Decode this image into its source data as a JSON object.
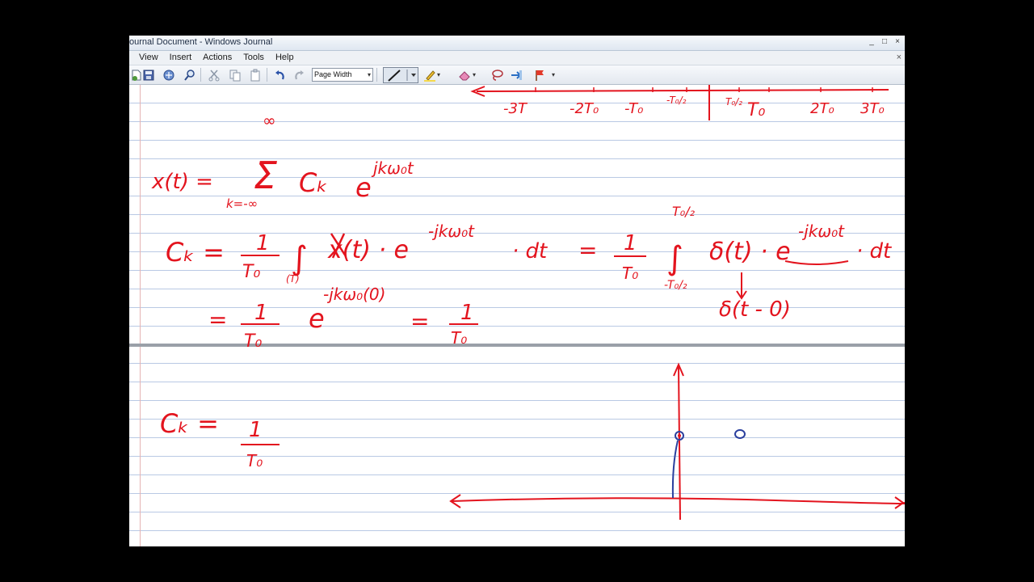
{
  "window": {
    "title": "ournal Document - Windows Journal",
    "controls": [
      "_",
      "□",
      "×"
    ]
  },
  "menu": {
    "items": [
      "View",
      "Insert",
      "Actions",
      "Tools",
      "Help"
    ],
    "close_glyph": "×"
  },
  "toolbar": {
    "icons": [
      "new-page-icon",
      "save-icon",
      "email-icon",
      "find-icon",
      "cut-icon",
      "copy-icon",
      "paste-icon",
      "undo-icon",
      "redo-icon",
      "pen-icon",
      "highlighter-icon",
      "eraser-icon",
      "lasso-icon",
      "insert-space-icon",
      "flag-icon"
    ],
    "zoom_value": "Page Width",
    "dropdown_arrow": "▾"
  },
  "ink": {
    "color": "#e3141e",
    "axis_top_labels": [
      "-3T",
      "-2T₀",
      "-T₀",
      "-T₀/₂",
      "T₀/₂",
      "T₀",
      "2T₀",
      "3T₀"
    ],
    "eq_x_lhs": "x(t) =",
    "eq_sum": "Σ",
    "eq_inf_top": "∞",
    "eq_inf_bottom": "k=-∞",
    "eq_ck": "Cₖ",
    "eq_e": "e",
    "eq_exp": "jkω₀t",
    "ck_lhs": "Cₖ =",
    "one": "1",
    "t0": "T₀",
    "integral": "∫",
    "int_sub": "(T)",
    "x_of_t": "x(t) · e",
    "neg_exp": "-jkω₀t",
    "dt": "· dt",
    "equals": "=",
    "delta_t": "δ(t) · e",
    "lim_top": "T₀/₂",
    "lim_bottom": "-T₀/₂",
    "delta_shift": "δ(t - 0)",
    "zero_exp": "-jkω₀(0)",
    "eq2": "=",
    "ck2_lhs": "Cₖ =",
    "marker_color": "#2a3f9e"
  }
}
